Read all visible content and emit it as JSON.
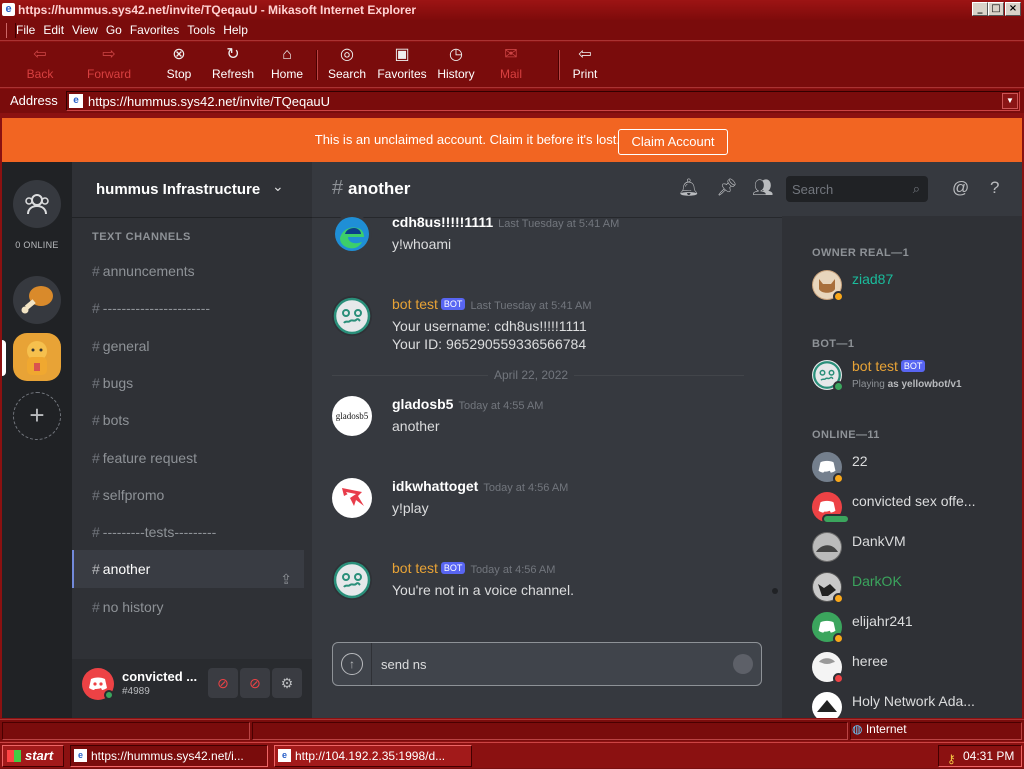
{
  "window": {
    "title": "https://hummus.sys42.net/invite/TQeqauU - Mikasoft Internet Explorer",
    "controls": [
      "_",
      "□",
      "×"
    ]
  },
  "menu": [
    "File",
    "Edit",
    "View",
    "Go",
    "Favorites",
    "Tools",
    "Help"
  ],
  "toolbar": {
    "back": "Back",
    "forward": "Forward",
    "stop": "Stop",
    "refresh": "Refresh",
    "home": "Home",
    "search": "Search",
    "favorites": "Favorites",
    "history": "History",
    "mail": "Mail",
    "print": "Print"
  },
  "address": {
    "label": "Address",
    "url": "https://hummus.sys42.net/invite/TQeqauU"
  },
  "banner": {
    "text": "This is an unclaimed account. Claim it before it's lost.",
    "button": "Claim Account",
    "color": "#f26522"
  },
  "rail": {
    "online_count": "0 ONLINE"
  },
  "server": {
    "name": "hummus Infrastructure",
    "category": "TEXT CHANNELS",
    "channels": [
      {
        "name": "annuncements"
      },
      {
        "name": "-----------------------"
      },
      {
        "name": "general"
      },
      {
        "name": "bugs"
      },
      {
        "name": "bots"
      },
      {
        "name": "feature request"
      },
      {
        "name": "selfpromo"
      },
      {
        "name": "---------tests---------"
      },
      {
        "name": "another",
        "active": true
      },
      {
        "name": "no history"
      }
    ]
  },
  "user": {
    "name": "convicted ...",
    "tag": "#4989"
  },
  "chat": {
    "channel": "another",
    "search_placeholder": "Search",
    "date_divider": "April 22, 2022",
    "composer_text": "send ns",
    "messages": [
      {
        "author": "cdh8us!!!!!1111",
        "time": "Last Tuesday at 5:41 AM",
        "lines": [
          "y!whoami"
        ],
        "bot": false
      },
      {
        "author": "bot test",
        "badge": "BOT",
        "time": "Last Tuesday at 5:41 AM",
        "lines": [
          "Your username: cdh8us!!!!!1111",
          "Your ID: 965290559336566784"
        ],
        "bot": true
      },
      {
        "author": "gladosb5",
        "avatar_text": "gladosb5",
        "time": "Today at 4:55 AM",
        "lines": [
          "another"
        ],
        "bot": false
      },
      {
        "author": "idkwhattoget",
        "time": "Today at 4:56 AM",
        "lines": [
          "y!play"
        ],
        "bot": false
      },
      {
        "author": "bot test",
        "badge": "BOT",
        "time": "Today at 4:56 AM",
        "lines": [
          "You're not in a voice channel."
        ],
        "bot": true
      }
    ]
  },
  "members": {
    "groups": [
      {
        "header": "OWNER REAL—1",
        "members": [
          {
            "name": "ziad87",
            "color": "#1abc9c",
            "status": "idle"
          }
        ]
      },
      {
        "header": "BOT—1",
        "members": [
          {
            "name": "bot test",
            "badge": "BOT",
            "color": "#e8a336",
            "status": "online",
            "activity_prefix": "Playing",
            "activity": "as yellowbot/v1"
          }
        ]
      },
      {
        "header": "ONLINE—11",
        "members": [
          {
            "name": "22",
            "color": "#dcddde",
            "status": "idle"
          },
          {
            "name": "convicted sex offe...",
            "color": "#dcddde",
            "status": "typing"
          },
          {
            "name": "DankVM",
            "color": "#dcddde",
            "status": "none"
          },
          {
            "name": "DarkOK",
            "color": "#3ba55d",
            "status": "idle"
          },
          {
            "name": "elijahr241",
            "color": "#dcddde",
            "status": "idle"
          },
          {
            "name": "heree",
            "color": "#dcddde",
            "status": "dnd"
          },
          {
            "name": "Holy Network Ada...",
            "color": "#dcddde",
            "status": "none"
          }
        ]
      }
    ]
  },
  "statusbar": {
    "zone": "Internet"
  },
  "taskbar": {
    "start": "start",
    "tasks": [
      "https://hummus.sys42.net/i...",
      "http://104.192.2.35:1998/d..."
    ],
    "clock": "04:31 PM"
  }
}
